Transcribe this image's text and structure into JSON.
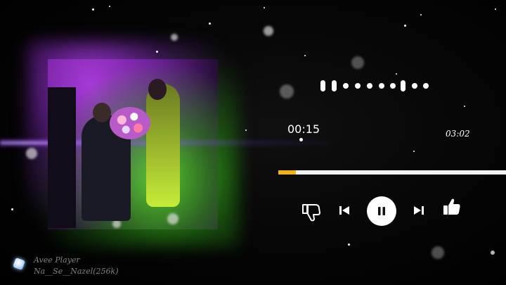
{
  "player": {
    "current_time": "00:15",
    "total_time": "03:02",
    "progress": 0.077
  },
  "controls": {
    "dislike": "thumbs-down-icon",
    "previous": "skip-previous-icon",
    "play_pause": "pause-icon",
    "next": "skip-next-icon",
    "like": "thumbs-up-icon"
  },
  "watermark": {
    "line1": "Avee Player",
    "line2": "Na__Se__Nazel(256k)"
  },
  "colors": {
    "background": "#000000",
    "progress_fill": "#f0b41a",
    "progress_track": "#f2f2f2",
    "glow_purple": "#a63ad6",
    "glow_green": "#4dd21e"
  }
}
